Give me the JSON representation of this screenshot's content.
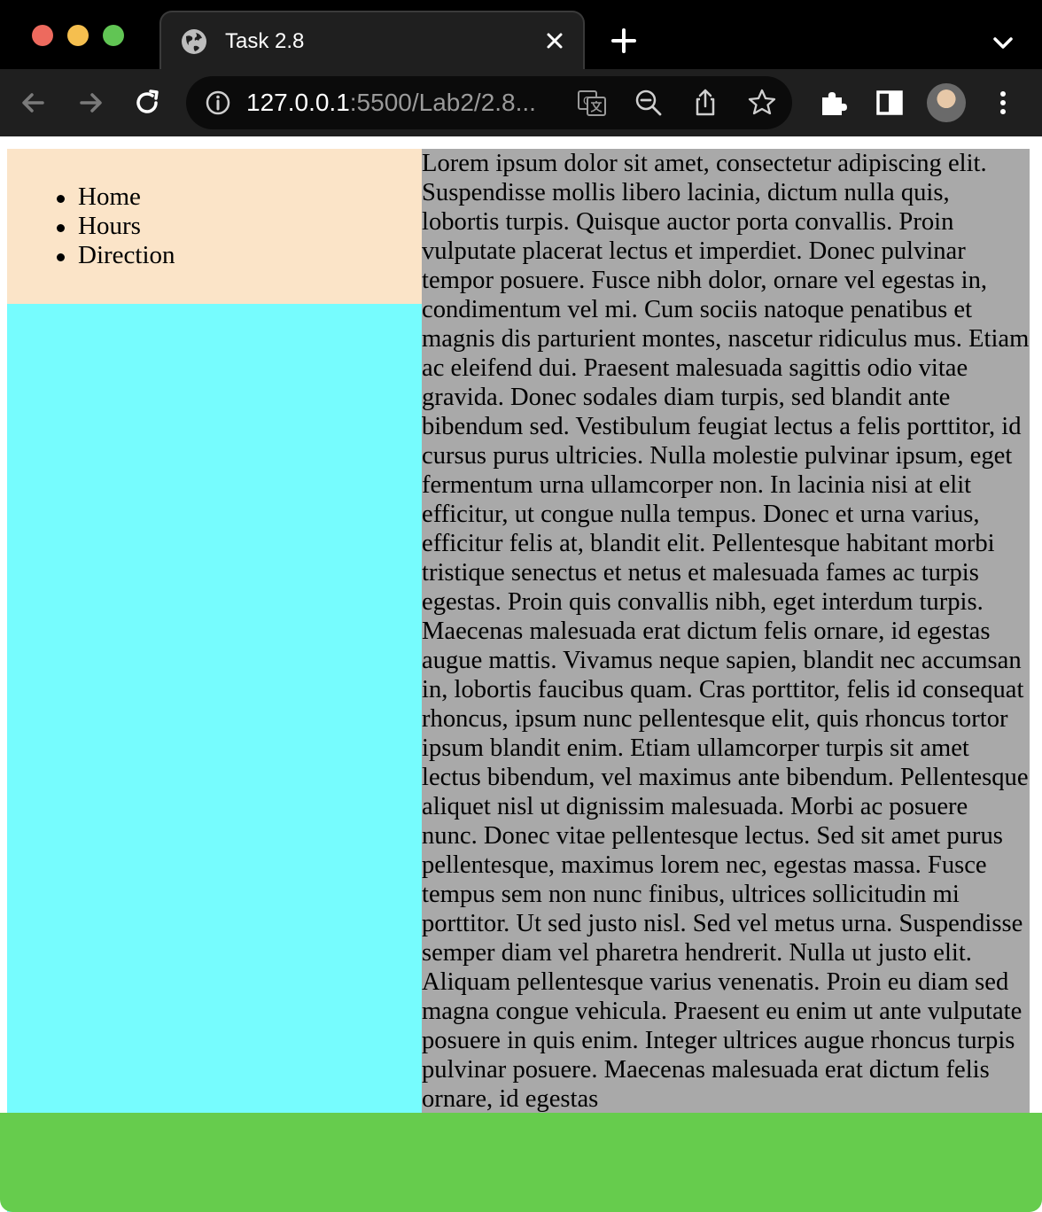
{
  "browser": {
    "tab": {
      "title": "Task 2.8"
    },
    "address_bar": {
      "host": "127.0.0.1",
      "path": ":5500/Lab2/2.8..."
    }
  },
  "page": {
    "nav": {
      "items": [
        "Home",
        "Hours",
        "Direction"
      ]
    },
    "content": {
      "text": "Lorem ipsum dolor sit amet, consectetur adipiscing elit. Suspendisse mollis libero lacinia, dictum nulla quis, lobortis turpis. Quisque auctor porta convallis. Proin vulputate placerat lectus et imperdiet. Donec pulvinar tempor posuere. Fusce nibh dolor, ornare vel egestas in, condimentum vel mi. Cum sociis natoque penatibus et magnis dis parturient montes, nascetur ridiculus mus. Etiam ac eleifend dui. Praesent malesuada sagittis odio vitae gravida. Donec sodales diam turpis, sed blandit ante bibendum sed. Vestibulum feugiat lectus a felis porttitor, id cursus purus ultricies. Nulla molestie pulvinar ipsum, eget fermentum urna ullamcorper non. In lacinia nisi at elit efficitur, ut congue nulla tempus. Donec et urna varius, efficitur felis at, blandit elit. Pellentesque habitant morbi tristique senectus et netus et malesuada fames ac turpis egestas. Proin quis convallis nibh, eget interdum turpis. Maecenas malesuada erat dictum felis ornare, id egestas augue mattis. Vivamus neque sapien, blandit nec accumsan in, lobortis faucibus quam. Cras porttitor, felis id consequat rhoncus, ipsum nunc pellentesque elit, quis rhoncus tortor ipsum blandit enim. Etiam ullamcorper turpis sit amet lectus bibendum, vel maximus ante bibendum. Pellentesque aliquet nisl ut dignissim malesuada. Morbi ac posuere nunc. Donec vitae pellentesque lectus. Sed sit amet purus pellentesque, maximus lorem nec, egestas massa. Fusce tempus sem non nunc finibus, ultrices sollicitudin mi porttitor. Ut sed justo nisl. Sed vel metus urna. Suspendisse semper diam vel pharetra hendrerit. Nulla ut justo elit. Aliquam pellentesque varius venenatis. Proin eu diam sed magna congue vehicula. Praesent eu enim ut ante vulputate posuere in quis enim. Integer ultrices augue rhoncus turpis pulvinar posuere. Maecenas malesuada erat dictum felis ornare, id egestas"
    }
  },
  "colors": {
    "nav_bg": "#FBE4C8",
    "sidebar_bg": "#76FCFE",
    "content_bg": "#A9A9A9",
    "footer_bg": "#66CC4D"
  },
  "icons": [
    "globe-icon",
    "close-icon",
    "plus-icon",
    "chevron-down-icon",
    "back-arrow-icon",
    "forward-arrow-icon",
    "reload-icon",
    "info-icon",
    "translate-icon",
    "zoom-out-icon",
    "share-icon",
    "star-icon",
    "puzzle-icon",
    "side-panel-icon",
    "more-vert-icon"
  ]
}
